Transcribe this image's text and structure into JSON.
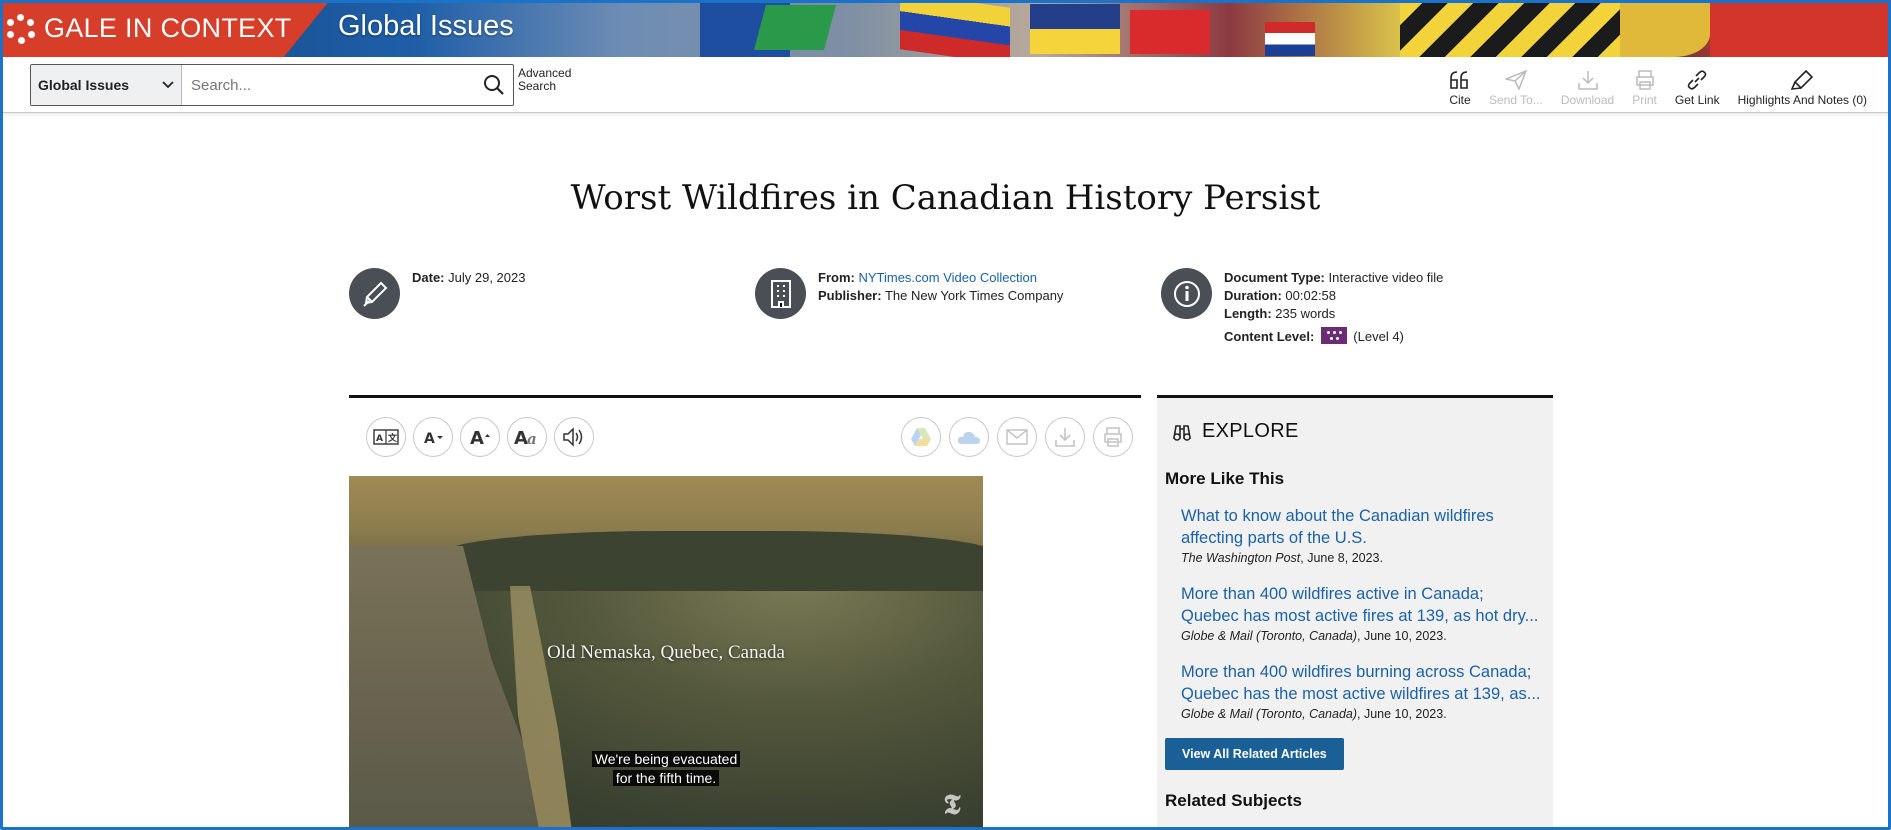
{
  "banner": {
    "brand": "GALE IN CONTEXT",
    "product": "Global Issues"
  },
  "search": {
    "scope": "Global Issues",
    "placeholder": "Search...",
    "advanced_line1": "Advanced",
    "advanced_line2": "Search"
  },
  "tools": [
    {
      "label": "Cite",
      "icon": "cite-icon",
      "enabled": true
    },
    {
      "label": "Send To...",
      "icon": "send-icon",
      "enabled": false
    },
    {
      "label": "Download",
      "icon": "download-icon",
      "enabled": false
    },
    {
      "label": "Print",
      "icon": "print-icon",
      "enabled": false
    },
    {
      "label": "Get Link",
      "icon": "link-icon",
      "enabled": true
    },
    {
      "label": "Highlights And Notes (0)",
      "icon": "highlighter-icon",
      "enabled": true
    }
  ],
  "document": {
    "title": "Worst Wildfires in Canadian History Persist",
    "date_label": "Date:",
    "date": "July 29, 2023",
    "from_label": "From:",
    "from": "NYTimes.com Video Collection",
    "publisher_label": "Publisher:",
    "publisher": "The New York Times Company",
    "doctype_label": "Document Type:",
    "doctype": "Interactive video file",
    "duration_label": "Duration:",
    "duration": "00:02:58",
    "length_label": "Length:",
    "length": "235 words",
    "content_level_label": "Content Level:",
    "content_level": "(Level 4)"
  },
  "reader_tools": [
    "translate-icon",
    "font-size-icon",
    "text-size-icon",
    "font-style-icon",
    "listen-icon"
  ],
  "share_tools": [
    "google-drive-icon",
    "onedrive-icon",
    "email-icon",
    "download-icon",
    "print-icon"
  ],
  "video": {
    "location_caption": "Old Nemaska, Quebec, Canada",
    "subtitle_line1": "We're being evacuated",
    "subtitle_line2": "for the fifth time."
  },
  "explore": {
    "heading": "EXPLORE",
    "more_like_this": "More Like This",
    "articles": [
      {
        "title_line1": "What to know about the Canadian wildfires",
        "title_line2": "affecting parts of the U.S.",
        "source": "The Washington Post",
        "date": ", June 8, 2023."
      },
      {
        "title_line1": "More than 400 wildfires active in Canada;",
        "title_line2": "Quebec has most active fires at 139, as hot dry...",
        "source": "Globe & Mail (Toronto, Canada)",
        "date": ", June 10, 2023."
      },
      {
        "title_line1": "More than 400 wildfires burning across Canada;",
        "title_line2": "Quebec has the most active wildfires at 139, as...",
        "source": "Globe & Mail (Toronto, Canada)",
        "date": ", June 10, 2023."
      }
    ],
    "view_all": "View All Related Articles",
    "related_subjects": "Related Subjects"
  },
  "colors": {
    "brand": "#d63e2a",
    "link": "#1a62a6",
    "button": "#1a5f95",
    "frame": "#1a73c8"
  }
}
